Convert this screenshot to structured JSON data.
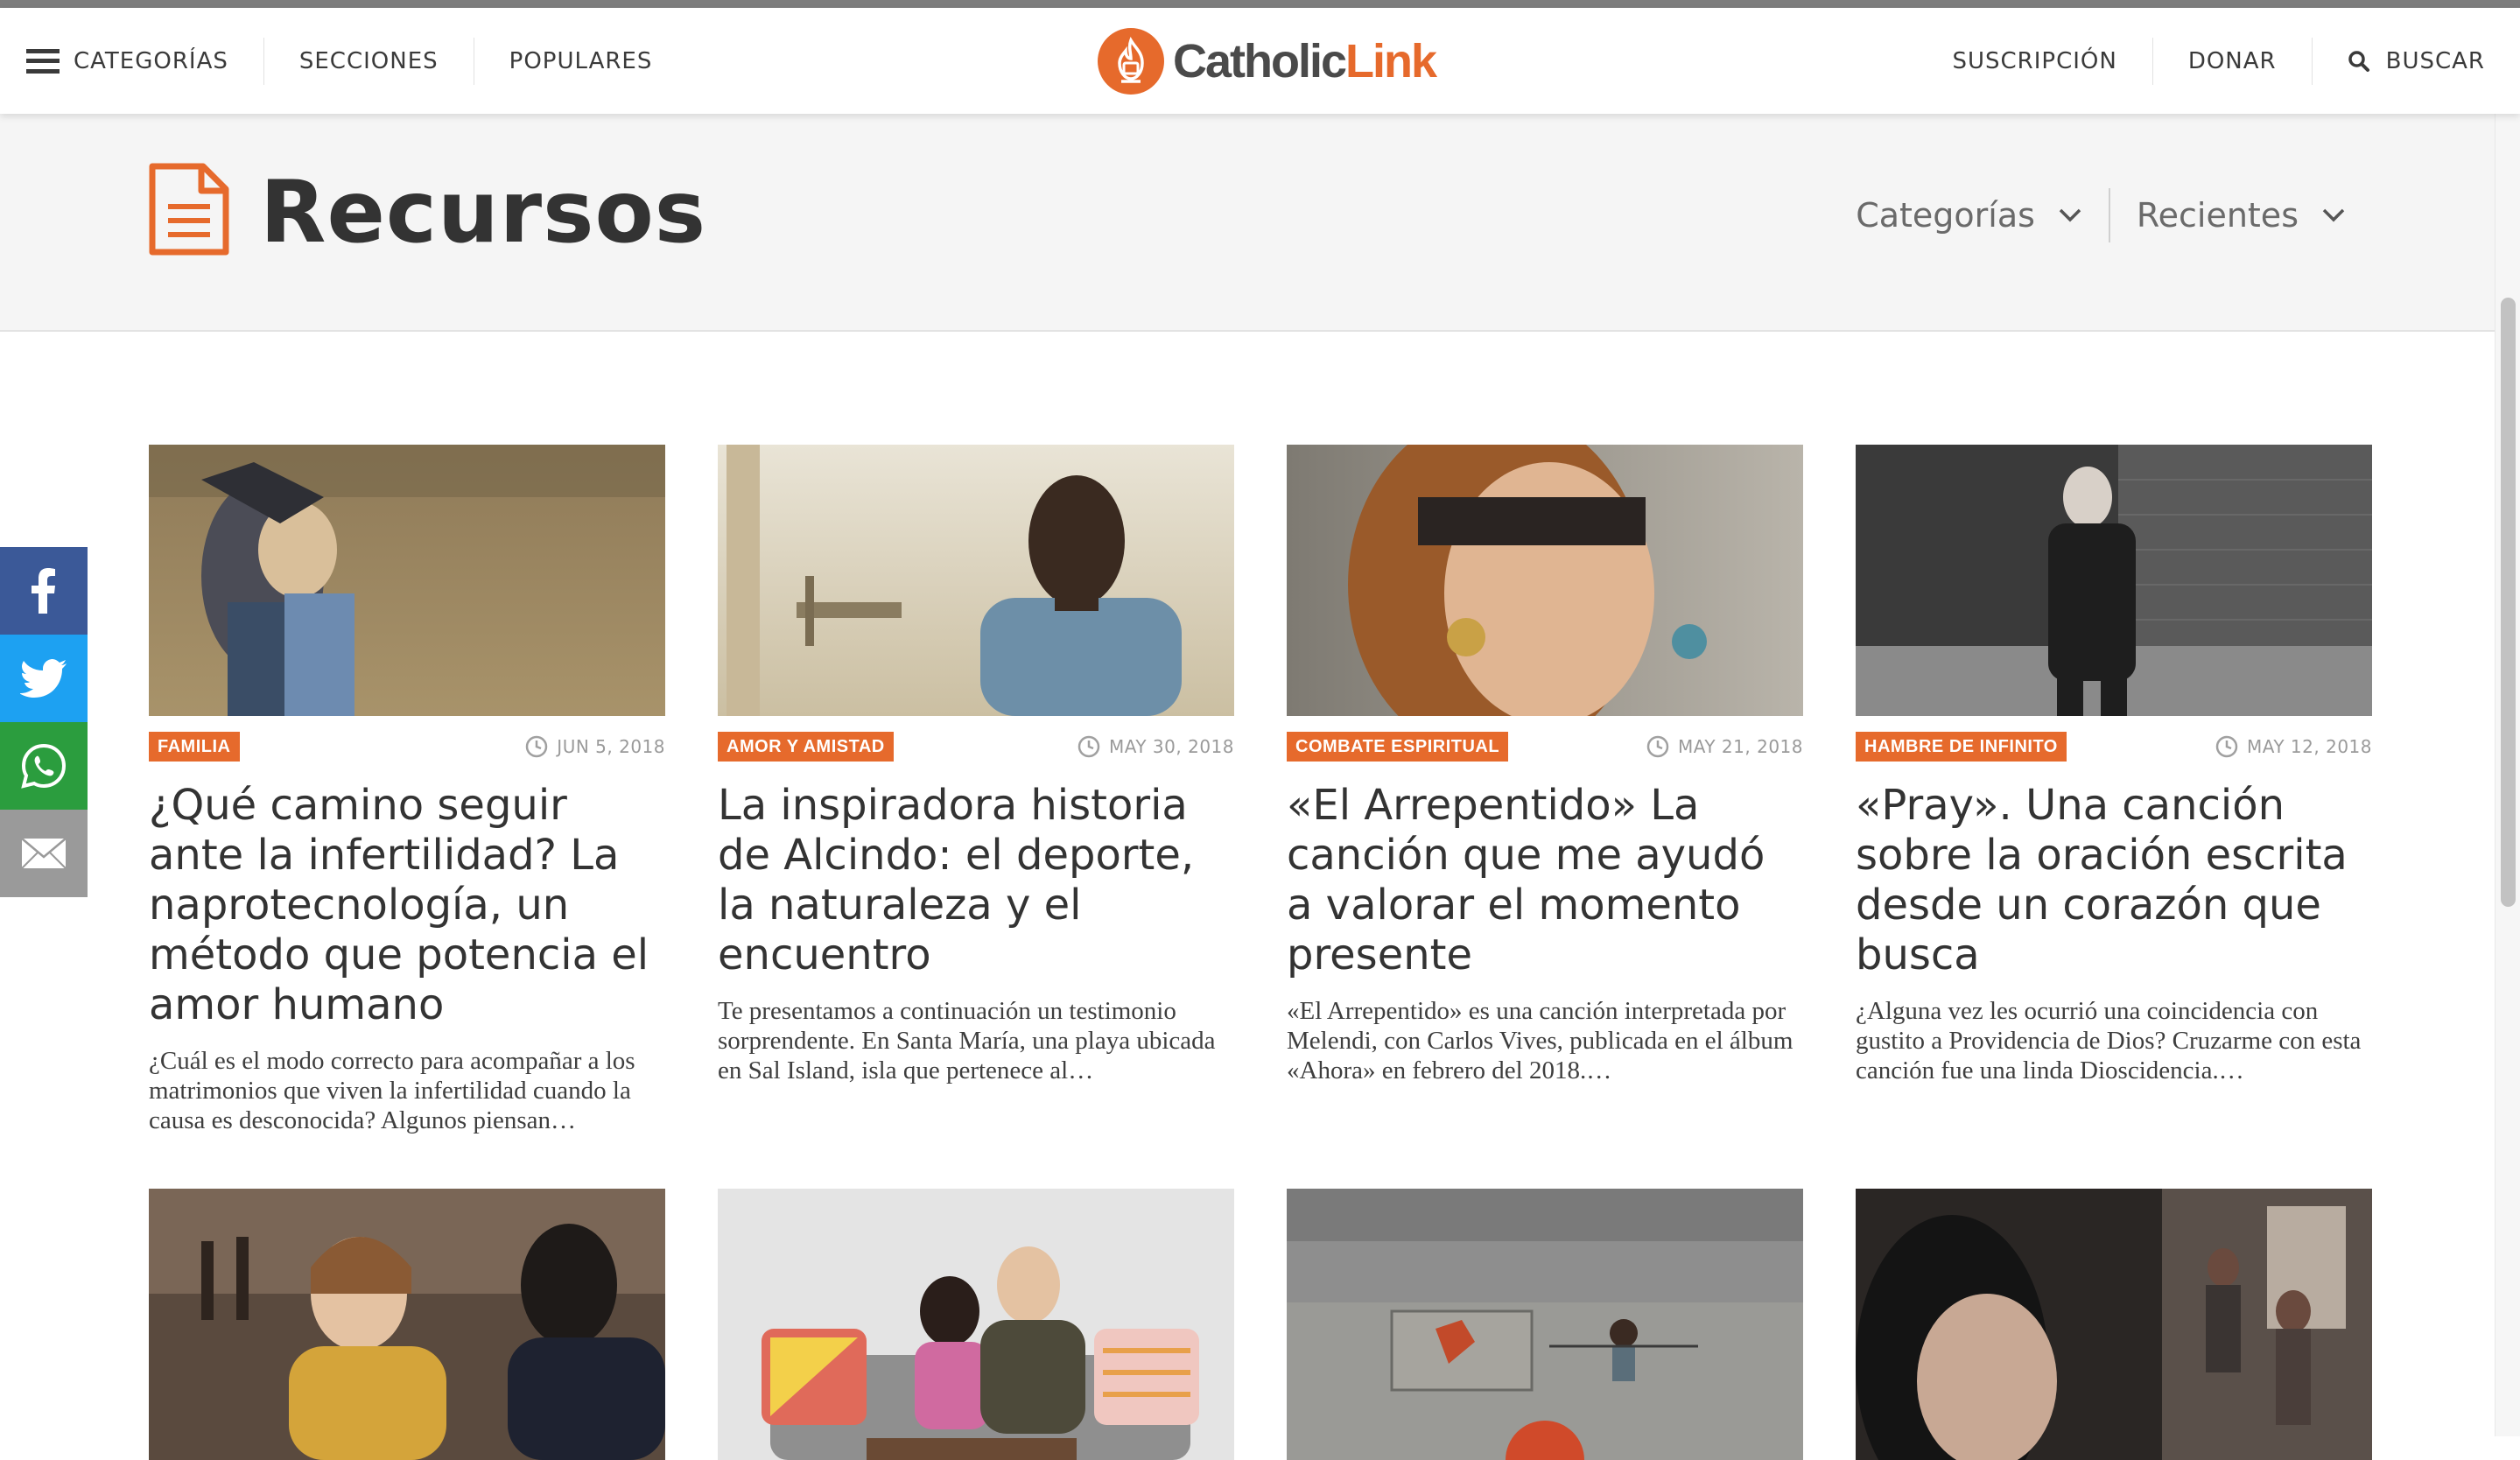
{
  "header": {
    "nav_left": [
      "CATEGORÍAS",
      "SECCIONES",
      "POPULARES"
    ],
    "logo": {
      "part1": "Catholic",
      "part2": "Link"
    },
    "nav_right": {
      "subscription": "SUSCRIPCIÓN",
      "donate": "DONAR",
      "search": "BUSCAR"
    }
  },
  "page": {
    "title": "Recursos",
    "filters": [
      {
        "label": "Categorías"
      },
      {
        "label": "Recientes"
      }
    ]
  },
  "share": [
    "facebook",
    "twitter",
    "whatsapp",
    "email"
  ],
  "colors": {
    "accent": "#e66a2c",
    "facebook": "#3b5998",
    "twitter": "#1da1f2",
    "whatsapp": "#2b9d3e",
    "email": "#9a9a9a"
  },
  "cards": [
    {
      "tag": "FAMILIA",
      "date": "JUN 5, 2018",
      "title": "¿Qué camino seguir ante la infertilidad? La naprotecnología, un método que potencia el amor humano",
      "excerpt": "¿Cuál es el modo correcto para acompañar a los matrimonios que viven la infertilidad cuando la causa es desconocida? Algunos piensan…"
    },
    {
      "tag": "AMOR Y AMISTAD",
      "date": "MAY 30, 2018",
      "title": "La inspiradora historia de Alcindo: el deporte, la naturaleza y el encuentro",
      "excerpt": "Te presentamos a continuación un testimonio sorprendente. En Santa María, una playa ubicada en Sal Island, isla que pertenece al…"
    },
    {
      "tag": "COMBATE ESPIRITUAL",
      "date": "MAY 21, 2018",
      "title": "«El Arrepentido» La canción que me ayudó a valorar el momento presente",
      "excerpt": "«El Arrepentido» es una canción interpretada por Melendi, con Carlos Vives, publicada en el álbum «Ahora» en febrero del 2018.…"
    },
    {
      "tag": "HAMBRE DE INFINITO",
      "date": "MAY 12, 2018",
      "title": "«Pray». Una canción sobre la oración escrita desde un corazón que busca",
      "excerpt": "¿Alguna vez les ocurrió una coincidencia con gustito a Providencia de Dios? Cruzarme con esta canción fue una linda Dioscidencia.…"
    }
  ]
}
